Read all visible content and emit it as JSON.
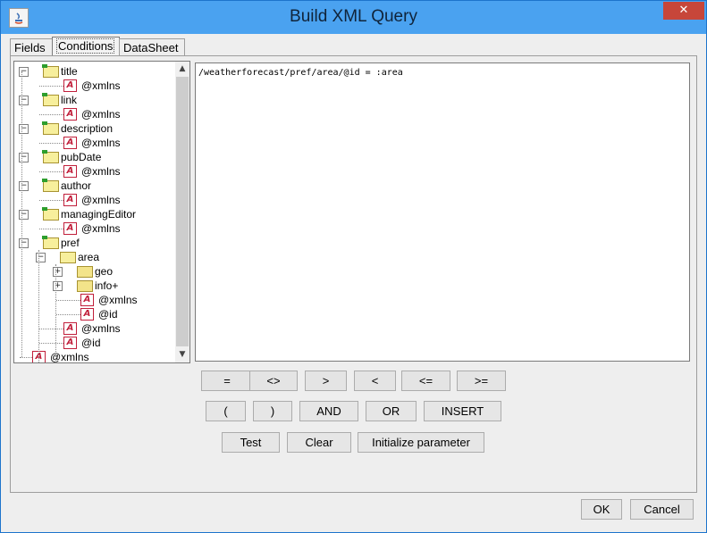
{
  "window": {
    "title": "Build XML Query",
    "close_label": "✕",
    "app_icon": "java-icon"
  },
  "tabs": [
    {
      "label": "Fields"
    },
    {
      "label": "Conditions"
    },
    {
      "label": "DataSheet"
    }
  ],
  "tree": [
    {
      "label": "title",
      "type": "folder"
    },
    {
      "label": "@xmlns",
      "type": "attr"
    },
    {
      "label": "link",
      "type": "folder"
    },
    {
      "label": "@xmlns",
      "type": "attr"
    },
    {
      "label": "description",
      "type": "folder"
    },
    {
      "label": "@xmlns",
      "type": "attr"
    },
    {
      "label": "pubDate",
      "type": "folder"
    },
    {
      "label": "@xmlns",
      "type": "attr"
    },
    {
      "label": "author",
      "type": "folder"
    },
    {
      "label": "@xmlns",
      "type": "attr"
    },
    {
      "label": "managingEditor",
      "type": "folder"
    },
    {
      "label": "@xmlns",
      "type": "attr"
    },
    {
      "label": "pref",
      "type": "folder"
    },
    {
      "label": "area",
      "type": "folder"
    },
    {
      "label": "geo",
      "type": "folder"
    },
    {
      "label": "info+",
      "type": "folder"
    },
    {
      "label": "@xmlns",
      "type": "attr"
    },
    {
      "label": "@id",
      "type": "attr"
    },
    {
      "label": "@xmlns",
      "type": "attr"
    },
    {
      "label": "@id",
      "type": "attr"
    },
    {
      "label": "@xmlns",
      "type": "attr"
    }
  ],
  "query_text": "/weatherforecast/pref/area/@id = :area",
  "operators": [
    "=",
    "<>",
    ">",
    "<",
    "<=",
    ">="
  ],
  "logic_buttons": [
    "(",
    ")",
    "AND",
    "OR",
    "INSERT"
  ],
  "action_buttons": [
    "Test",
    "Clear",
    "Initialize parameter"
  ],
  "dialog_buttons": {
    "ok": "OK",
    "cancel": "Cancel"
  }
}
